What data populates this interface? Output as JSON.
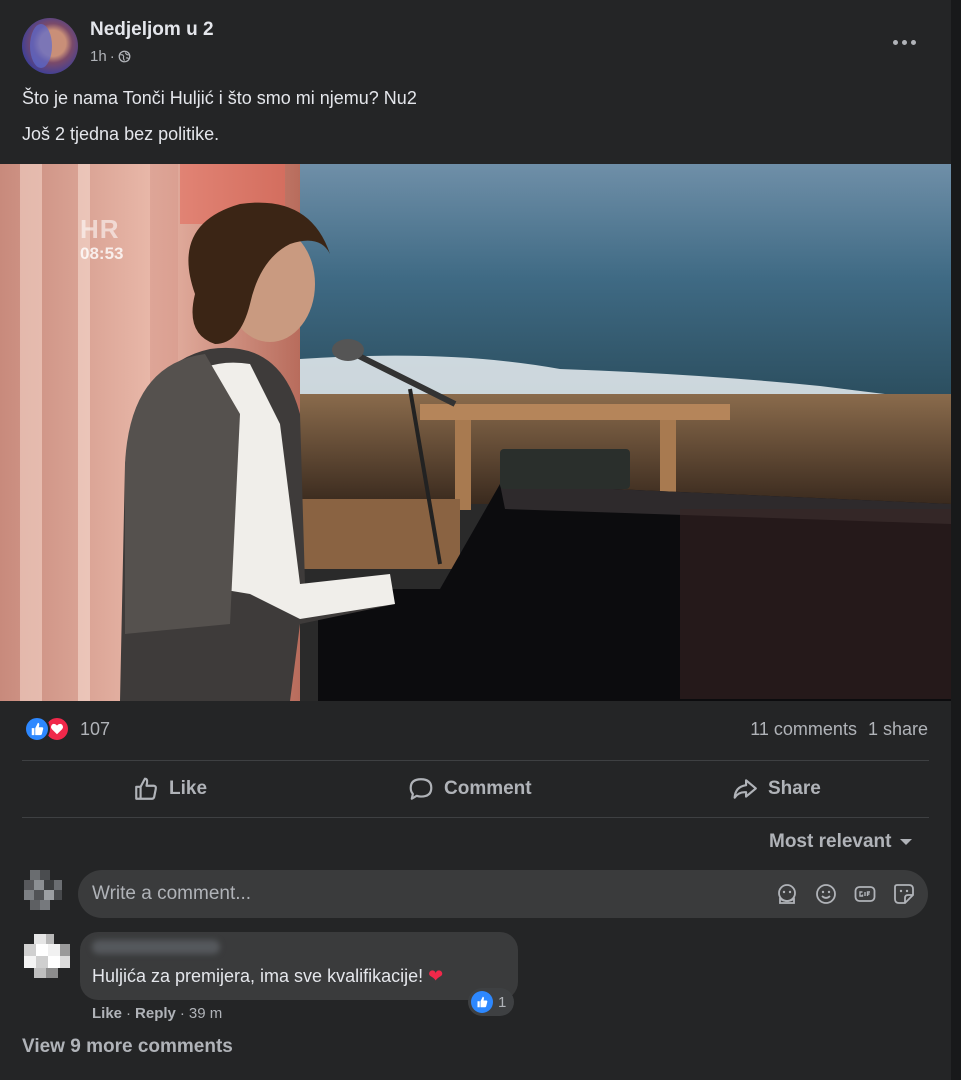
{
  "post": {
    "page_name": "Nedjeljom u 2",
    "time": "1h",
    "separator": "·",
    "privacy_icon": "globe-icon",
    "text_line1": "Što je nama Tonči Huljić i što smo mi njemu? Nu2",
    "text_line2": "Još 2 tjedna bez politike.",
    "media": {
      "channel_logo": "HR",
      "clock": "08:53"
    }
  },
  "engagement": {
    "reaction_icons": [
      "like-icon",
      "love-icon"
    ],
    "reaction_count": "107",
    "comments": "11 comments",
    "shares": "1 share"
  },
  "actions": {
    "like": "Like",
    "comment": "Comment",
    "share": "Share"
  },
  "comments_section": {
    "sort_label": "Most relevant",
    "input_placeholder": "Write a comment...",
    "input_icons": [
      "avatar-sticker-icon",
      "emoji-icon",
      "gif-icon",
      "sticker-icon"
    ],
    "comments": [
      {
        "text": "Huljića za premijera, ima sve kvalifikacije!",
        "emoji": "❤",
        "reaction_count": "1",
        "like": "Like",
        "reply": "Reply",
        "time": "39 m"
      }
    ],
    "view_more": "View 9 more comments"
  },
  "colors": {
    "background": "#242526",
    "text": "#e4e6eb",
    "muted": "#b0b3b8",
    "like_blue": "#2d88ff",
    "love_red": "#f0284a"
  }
}
